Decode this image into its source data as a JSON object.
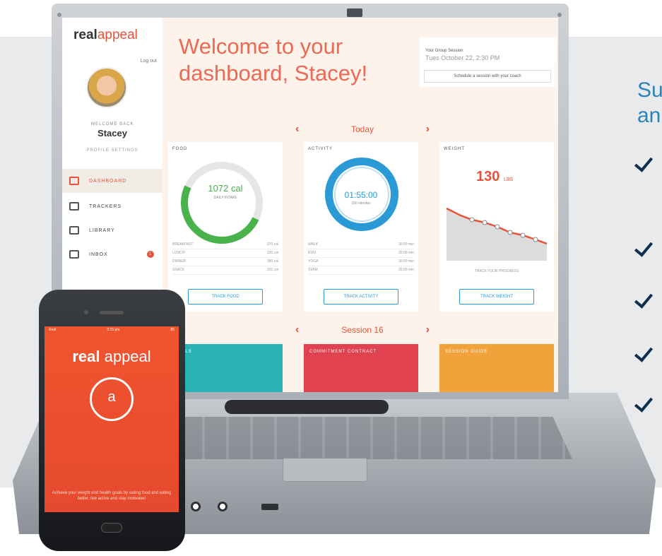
{
  "promo": {
    "heading_line1": "Su",
    "heading_line2": "an",
    "check_count": 5
  },
  "dashboard": {
    "brand_primary": "real",
    "brand_secondary": "appeal",
    "logout_label": "Log out",
    "welcome_back_label": "WELCOME BACK",
    "user_name": "Stacey",
    "profile_settings_label": "PROFILE SETTINGS",
    "nav": [
      {
        "label": "DASHBOARD",
        "icon": "dashboard-icon",
        "active": true
      },
      {
        "label": "TRACKERS",
        "icon": "trackers-icon",
        "active": false
      },
      {
        "label": "LIBRARY",
        "icon": "library-icon",
        "active": false
      },
      {
        "label": "INBOX",
        "icon": "inbox-icon",
        "active": false,
        "badge": "1"
      }
    ],
    "welcome_title": "Welcome to your dashboard, Stacey!",
    "group_session": {
      "label": "Your Group Session",
      "time": "Tues October 22, 2:30 PM",
      "button": "Schedule a session with your coach"
    },
    "day_label": "Today",
    "food": {
      "title": "FOOD",
      "calories": "1072 cal",
      "calories_sub": "DAILY INTAKE",
      "goal_fraction": 0.55,
      "rows": [
        {
          "name": "BREAKFAST",
          "value": "370 cal"
        },
        {
          "name": "LUNCH",
          "value": "220 cal"
        },
        {
          "name": "DINNER",
          "value": "380 cal"
        },
        {
          "name": "SNACK",
          "value": "102 cal"
        }
      ],
      "button": "TRACK FOOD"
    },
    "activity": {
      "title": "ACTIVITY",
      "time": "01:55:00",
      "time_sub": "150 minutes",
      "rows": [
        {
          "name": "WALK",
          "value": "30:00 min"
        },
        {
          "name": "RUN",
          "value": "20:00 min"
        },
        {
          "name": "YOGA",
          "value": "30:00 min"
        },
        {
          "name": "SWIM",
          "value": "35:00 min"
        }
      ],
      "button": "TRACK ACTIVITY"
    },
    "weight": {
      "title": "WEIGHT",
      "value": "130",
      "unit": "LBS",
      "caption": "TRACK YOUR PROGRESS",
      "button": "TRACK WEIGHT"
    },
    "session_label": "Session 16",
    "tiles": [
      {
        "title": "GOALS",
        "color": "#2ab3b5"
      },
      {
        "title": "COMMITMENT CONTRACT",
        "color": "#e0434f"
      },
      {
        "title": "SESSION GUIDE",
        "color": "#f2a23a"
      }
    ]
  },
  "phone": {
    "carrier": "Real",
    "time": "3:15 pm",
    "battery": "85",
    "brand_primary": "real",
    "brand_secondary": "appeal",
    "badge_letter": "a",
    "caption": "Achieve your weight and health goals by eating food and eating better, live active and stay motivated"
  },
  "colors": {
    "accent": "#e8523a",
    "activity": "#2a9ad6",
    "food": "#49b24b",
    "promo": "#2a84b8"
  }
}
